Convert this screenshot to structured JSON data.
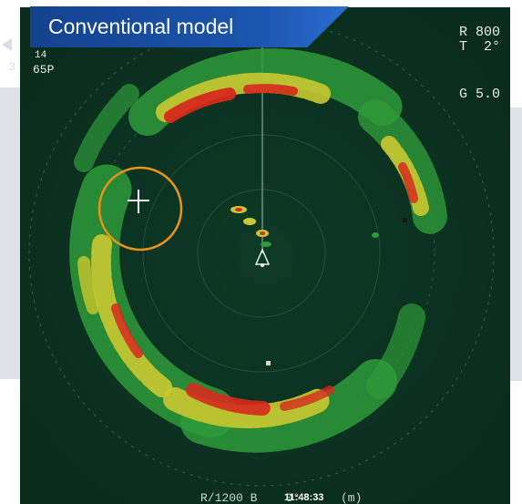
{
  "banner": {
    "label": "Conventional model"
  },
  "readouts": {
    "top_left_line1": "14",
    "top_left_line2": "65P",
    "range_label": "R 800",
    "tilt_label": "T  2°",
    "gain_label": "G 5.0",
    "bottom_range": "R/1200 B",
    "bottom_bearing": "0°",
    "clock": "11:48:33",
    "units": "(m)",
    "edge_digit": "3"
  },
  "colors": {
    "background": "#0f3a27",
    "echo_weak": "#2e9a3a",
    "echo_medium": "#c9c830",
    "echo_strong": "#d62a1e",
    "highlight_circle": "#e9921d",
    "banner_blue": "#1b55ad"
  },
  "icons": {
    "target_marker": "crosshair-plus",
    "own_ship": "ship-outline"
  }
}
